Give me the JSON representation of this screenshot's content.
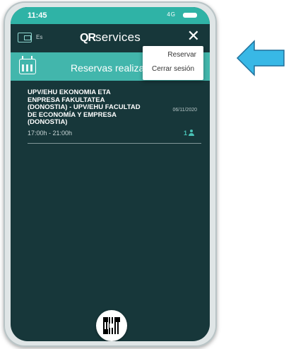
{
  "status_bar": {
    "time": "11:45",
    "network": "4G"
  },
  "header": {
    "language": "Es",
    "brand": {
      "mark": "QR",
      "suffix": "services"
    }
  },
  "banner": {
    "title": "Reservas realizadas"
  },
  "menu": {
    "items": [
      "Reservar",
      "Cerrar sesión"
    ]
  },
  "reservation": {
    "title": "UPV/EHU EKONOMIA ETA ENPRESA FAKULTATEA (DONOSTIA) - UPV/EHU FACULTAD DE ECONOMÍA Y EMPRESA (DONOSTIA)",
    "date": "06/11/2020",
    "time": "17:00h - 21:00h",
    "persons": "1"
  },
  "colors": {
    "accent": "#42b6ac",
    "screen_bg": "#17373a",
    "arrow": "#38b8e6"
  }
}
